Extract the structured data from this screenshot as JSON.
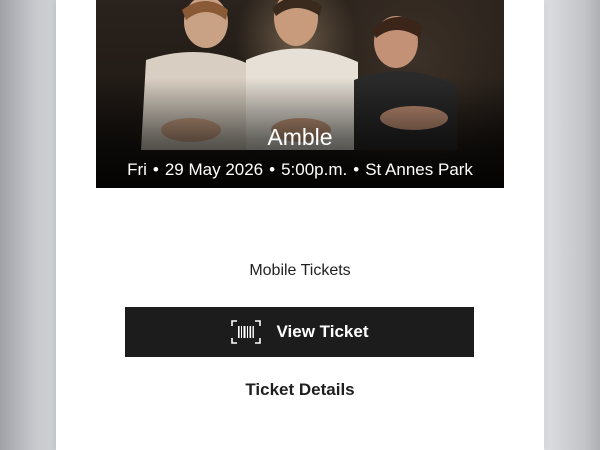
{
  "event": {
    "title": "Amble",
    "day": "Fri",
    "date": "29 May 2026",
    "time": "5:00p.m.",
    "venue": "St Annes Park",
    "separator": "•"
  },
  "tickets": {
    "section_label": "Mobile Tickets",
    "view_button_label": "View Ticket",
    "view_button_icon": "barcode-icon",
    "details_label": "Ticket Details"
  },
  "colors": {
    "button_bg": "#1c1c1c",
    "card_bg": "#ffffff",
    "text": "#1f1f1f"
  }
}
